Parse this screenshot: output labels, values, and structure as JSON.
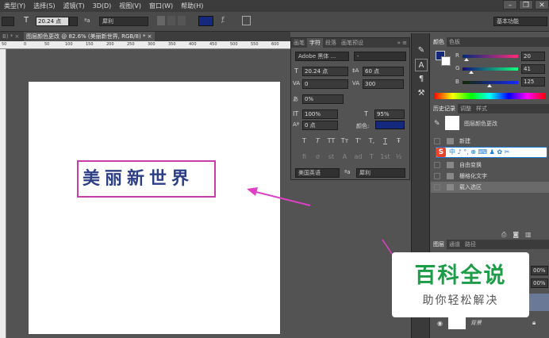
{
  "menu": {
    "items": [
      "类型(Y)",
      "选择(S)",
      "滤镜(T)",
      "3D(D)",
      "视图(V)",
      "窗口(W)",
      "帮助(H)"
    ],
    "window_buttons": [
      "–",
      "❐",
      "✕"
    ]
  },
  "options_bar": {
    "font_size": "20.24 点",
    "aa_label": "ªa",
    "aa_mode": "犀利",
    "workspace": "基本功能"
  },
  "tabs": {
    "tab1": "B) * ×",
    "tab2": "图层颜色更改 @ 82.6% (美丽新世界, RGB/8) * ×"
  },
  "ruler": {
    "marks": [
      "50",
      "0",
      "50",
      "100",
      "150",
      "200",
      "250",
      "300",
      "350",
      "400",
      "450",
      "500",
      "550",
      "600"
    ]
  },
  "canvas": {
    "text": "美丽新世界"
  },
  "character_panel": {
    "tabs": [
      "画笔",
      "字符",
      "段落",
      "画笔预设"
    ],
    "font_family": "Adobe 黑体 ...",
    "font_style": "-",
    "size": "20.24 点",
    "leading": "60 点",
    "kerning": "0",
    "tracking": "300",
    "scale_percent": "0%",
    "vertical_scale": "100%",
    "horizontal_scale": "95%",
    "baseline_shift": "0 点",
    "color_label": "颜色:",
    "style_buttons": [
      "T",
      "T",
      "TT",
      "Tт",
      "T'",
      "T,",
      "T",
      "Ŧ"
    ],
    "ot_buttons": [
      "fi",
      "σ",
      "st",
      "A",
      "ad",
      "T",
      "1st",
      "½"
    ],
    "language": "美国英语",
    "aa_label": "ªa",
    "aa_mode": "犀利"
  },
  "color_panel": {
    "tabs": [
      "颜色",
      "色板"
    ],
    "r_label": "R",
    "g_label": "G",
    "b_label": "B",
    "r": "20",
    "g": "41",
    "b": "125",
    "r_fraction": 0.078,
    "g_fraction": 0.161,
    "b_fraction": 0.49,
    "foreground_color": "#14297d"
  },
  "history_panel": {
    "tabs": [
      "历史记录",
      "调整",
      "样式"
    ],
    "snapshot": "图层颜色更改",
    "items": [
      "新建",
      "自由变换",
      "栅格化文字",
      "载入选区"
    ],
    "ime_bar": "中 ♪ °, ⊕ ⌨ ♟ ✿ ✂"
  },
  "layers_panel": {
    "tabs": [
      "图层",
      "通道",
      "路径"
    ],
    "opacity": "00%",
    "fill": "00%",
    "background_layer": "背景"
  },
  "overlay": {
    "title": "百科全说",
    "subtitle": "助你轻松解决"
  },
  "colors": {
    "accent_pink": "#c83ca8",
    "text_blue": "#2c3e86",
    "brand_green": "#1d9d47"
  }
}
